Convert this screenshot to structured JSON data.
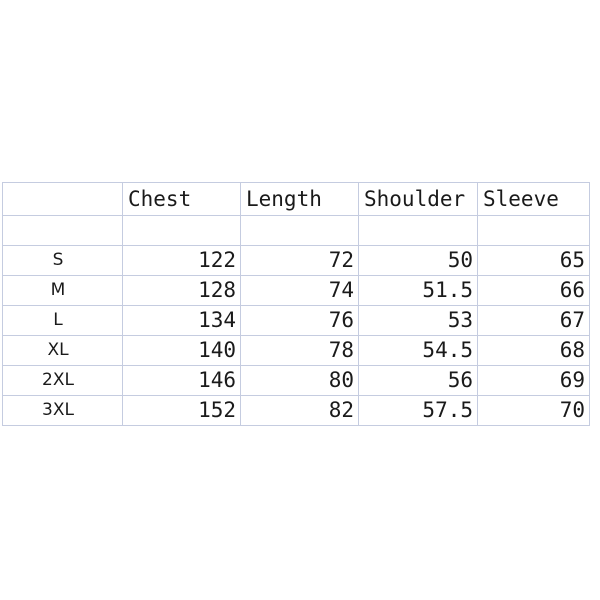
{
  "chart_data": {
    "type": "table",
    "title": "",
    "columns": [
      "",
      "Chest",
      "Length",
      "Shoulder",
      "Sleeve"
    ],
    "row_labels": [
      "S",
      "M",
      "L",
      "XL",
      "2XL",
      "3XL"
    ],
    "series": [
      {
        "name": "Chest",
        "values": [
          122,
          128,
          134,
          140,
          146,
          152
        ]
      },
      {
        "name": "Length",
        "values": [
          72,
          74,
          76,
          78,
          80,
          82
        ]
      },
      {
        "name": "Shoulder",
        "values": [
          50,
          51.5,
          53,
          54.5,
          56,
          57.5
        ]
      },
      {
        "name": "Sleeve",
        "values": [
          65,
          66,
          67,
          68,
          69,
          70
        ]
      }
    ],
    "rows": [
      {
        "size": "S",
        "chest": "122",
        "length": "72",
        "shoulder": "50",
        "sleeve": "65"
      },
      {
        "size": "M",
        "chest": "128",
        "length": "74",
        "shoulder": "51.5",
        "sleeve": "66"
      },
      {
        "size": "L",
        "chest": "134",
        "length": "76",
        "shoulder": "53",
        "sleeve": "67"
      },
      {
        "size": "XL",
        "chest": "140",
        "length": "78",
        "shoulder": "54.5",
        "sleeve": "68"
      },
      {
        "size": "2XL",
        "chest": "146",
        "length": "80",
        "shoulder": "56",
        "sleeve": "69"
      },
      {
        "size": "3XL",
        "chest": "152",
        "length": "82",
        "shoulder": "57.5",
        "sleeve": "70"
      }
    ],
    "spacer_row": {
      "size": "",
      "chest": "",
      "length": "",
      "shoulder": "",
      "sleeve": ""
    },
    "grid": true,
    "legend": "none"
  },
  "table": {
    "header": {
      "corner": "",
      "chest": "Chest",
      "length": "Length",
      "shoulder": "Shoulder",
      "sleeve": "Sleeve"
    },
    "spacer": {
      "corner": "",
      "chest": "",
      "length": "",
      "shoulder": "",
      "sleeve": ""
    },
    "rows": [
      {
        "size": "S",
        "chest": "122",
        "length": "72",
        "shoulder": "50",
        "sleeve": "65"
      },
      {
        "size": "M",
        "chest": "128",
        "length": "74",
        "shoulder": "51.5",
        "sleeve": "66"
      },
      {
        "size": "L",
        "chest": "134",
        "length": "76",
        "shoulder": "53",
        "sleeve": "67"
      },
      {
        "size": "XL",
        "chest": "140",
        "length": "78",
        "shoulder": "54.5",
        "sleeve": "68"
      },
      {
        "size": "2XL",
        "chest": "146",
        "length": "80",
        "shoulder": "56",
        "sleeve": "69"
      },
      {
        "size": "3XL",
        "chest": "152",
        "length": "82",
        "shoulder": "57.5",
        "sleeve": "70"
      }
    ]
  },
  "colors": {
    "border": "#c5cce0",
    "text": "#1a1a1a",
    "background": "#ffffff"
  }
}
